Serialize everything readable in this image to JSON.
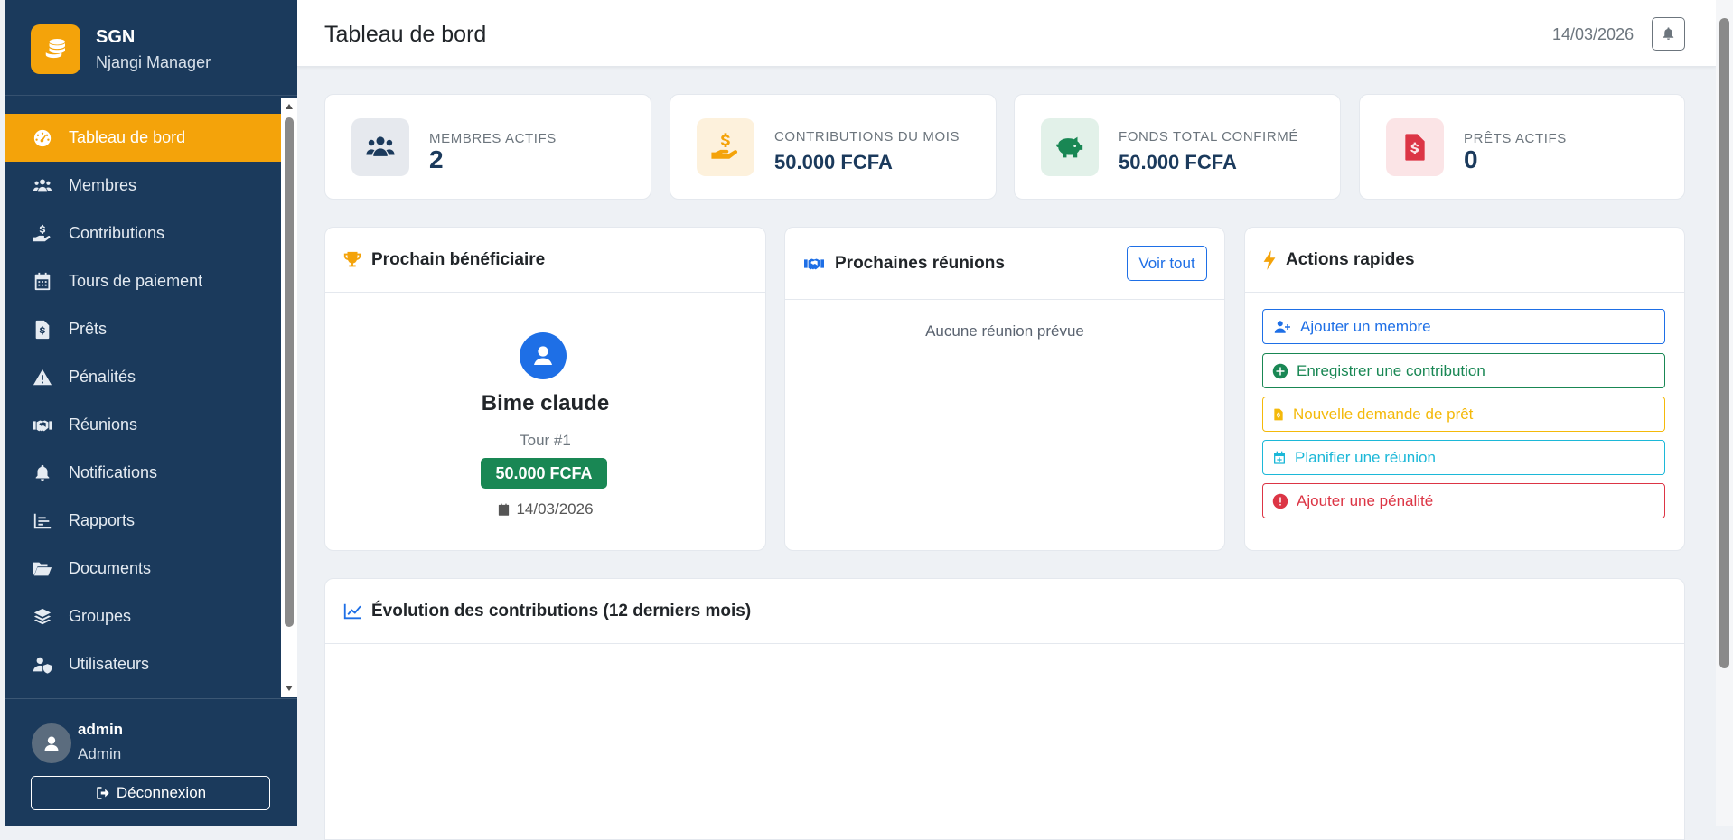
{
  "brand": {
    "name": "SGN",
    "subtitle": "Njangi Manager"
  },
  "sidebar": {
    "items": [
      {
        "label": "Tableau de bord",
        "icon": "gauge-icon",
        "active": true
      },
      {
        "label": "Membres",
        "icon": "users-icon"
      },
      {
        "label": "Contributions",
        "icon": "hand-coin-icon"
      },
      {
        "label": "Tours de paiement",
        "icon": "calendar-icon"
      },
      {
        "label": "Prêts",
        "icon": "invoice-dollar-icon"
      },
      {
        "label": "Pénalités",
        "icon": "warning-icon"
      },
      {
        "label": "Réunions",
        "icon": "handshake-icon"
      },
      {
        "label": "Notifications",
        "icon": "bell-icon"
      },
      {
        "label": "Rapports",
        "icon": "chart-icon"
      },
      {
        "label": "Documents",
        "icon": "folder-open-icon"
      },
      {
        "label": "Groupes",
        "icon": "layers-icon"
      },
      {
        "label": "Utilisateurs",
        "icon": "user-shield-icon"
      }
    ]
  },
  "user": {
    "name": "admin",
    "role": "Admin",
    "logout_label": "Déconnexion"
  },
  "header": {
    "title": "Tableau de bord",
    "date": "14/03/2026"
  },
  "stats": [
    {
      "label": "MEMBRES ACTIFS",
      "value": "2",
      "icon": "users-icon",
      "color": "#1b3a5c",
      "bg": "#e6e9ee"
    },
    {
      "label": "CONTRIBUTIONS DU MOIS",
      "value": "50.000 FCFA",
      "icon": "hand-coin-icon",
      "color": "#f4a30a",
      "bg": "#fdf1dc"
    },
    {
      "label": "FONDS TOTAL CONFIRMÉ",
      "value": "50.000 FCFA",
      "icon": "piggy-bank-icon",
      "color": "#198754",
      "bg": "#e2f1e9"
    },
    {
      "label": "PRÊTS ACTIFS",
      "value": "0",
      "icon": "invoice-dollar-icon",
      "color": "#dc3545",
      "bg": "#fbe4e6"
    }
  ],
  "beneficiary": {
    "title": "Prochain bénéficiaire",
    "name": "Bime claude",
    "tour": "Tour #1",
    "amount": "50.000 FCFA",
    "date": "14/03/2026"
  },
  "meetings": {
    "title": "Prochaines réunions",
    "view_all": "Voir tout",
    "empty": "Aucune réunion prévue"
  },
  "quick_actions": {
    "title": "Actions rapides",
    "items": [
      {
        "label": "Ajouter un membre",
        "color": "#1e6fe6",
        "icon": "user-plus-icon"
      },
      {
        "label": "Enregistrer une contribution",
        "color": "#198754",
        "icon": "plus-circle-icon"
      },
      {
        "label": "Nouvelle demande de prêt",
        "color": "#f4b90a",
        "icon": "file-dollar-icon"
      },
      {
        "label": "Planifier une réunion",
        "color": "#1cb8d8",
        "icon": "calendar-plus-icon"
      },
      {
        "label": "Ajouter une pénalité",
        "color": "#dc3545",
        "icon": "exclamation-circle-icon"
      }
    ]
  },
  "chart": {
    "title": "Évolution des contributions (12 derniers mois)"
  }
}
